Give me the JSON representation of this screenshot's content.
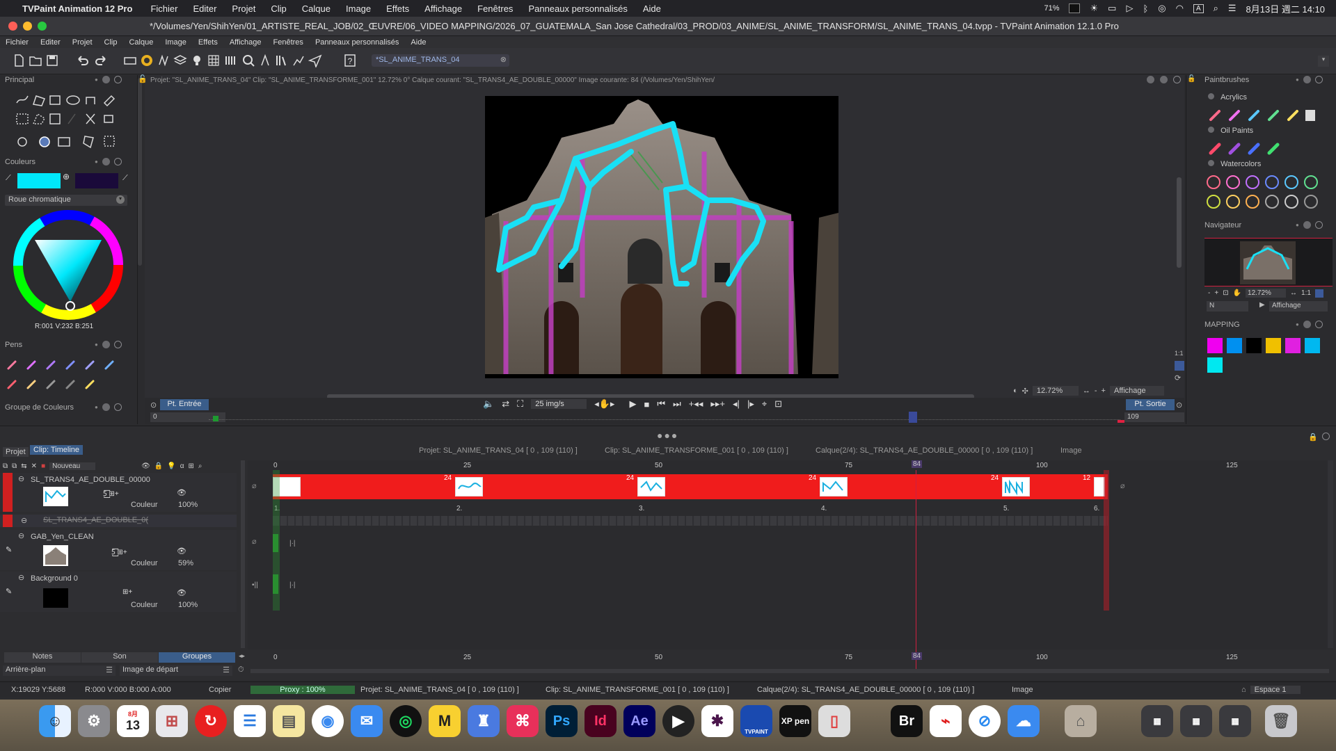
{
  "macbar": {
    "app_name": "TVPaint Animation 12 Pro",
    "menus": [
      "Fichier",
      "Editer",
      "Projet",
      "Clip",
      "Calque",
      "Image",
      "Effets",
      "Affichage",
      "Fenêtres",
      "Panneaux personnalisés",
      "Aide"
    ],
    "battery": "71%",
    "datetime": "8月13日 週二  14:10"
  },
  "titlebar": {
    "title": "*/Volumes/Yen/ShihYen/01_ARTISTE_REAL_JOB/02_ŒUVRE/06_VIDEO MAPPING/2026_07_GUATEMALA_San Jose Cathedral/03_PROD/03_ANIME/SL_ANIME_TRANSFORM/SL_ANIME_TRANS_04.tvpp - TVPaint Animation 12.1.0 Pro"
  },
  "appmenu": [
    "Fichier",
    "Editer",
    "Projet",
    "Clip",
    "Calque",
    "Image",
    "Effets",
    "Affichage",
    "Fenêtres",
    "Panneaux personnalisés",
    "Aide"
  ],
  "toolbar": {
    "tab_label": "*SL_ANIME_TRANS_04"
  },
  "infobar": {
    "text": "Projet: \"SL_ANIME_TRANS_04\"  Clip: \"SL_ANIME_TRANSFORME_001\"  12.72%  0°  Calque courant: \"SL_TRANS4_AE_DOUBLE_00000\"  Image courante: 84 (/Volumes/Yen/ShihYen/"
  },
  "left_panel": {
    "principal_title": "Principal",
    "couleurs_title": "Couleurs",
    "color_mode": "Roue chromatique",
    "rgb_readout": "R:001 V:232 B:251",
    "primary_color": "#00e8fb",
    "secondary_color": "#1a0a3a",
    "pens_title": "Pens",
    "groupe_title": "Groupe de Couleurs"
  },
  "right_panel": {
    "paintbrushes_title": "Paintbrushes",
    "acrylics": "Acrylics",
    "oil_paints": "Oil Paints",
    "watercolors": "Watercolors",
    "navigator_title": "Navigateur",
    "nav_zoom": "12.72%",
    "nav_mode": "N",
    "nav_display": "Affichage",
    "mapping_title": "MAPPING",
    "mapping_colors": [
      "#f000f0",
      "#0090f0",
      "#000000",
      "#f0c000",
      "#e020e0",
      "#00b8f0",
      "#00e8f0"
    ]
  },
  "viewer": {
    "pt_entree": "Pt. Entrée",
    "pt_sortie": "Pt. Sortie",
    "in_value": "0",
    "out_value": "109",
    "fps": "25 img/s",
    "zoom": "12.72%",
    "display": "Affichage"
  },
  "timeline": {
    "tabs": [
      "Projet",
      "Clip: Timeline"
    ],
    "nouveau": "Nouveau",
    "header_project": "Projet: SL_ANIME_TRANS_04 [ 0 , 109  (110) ]",
    "header_clip": "Clip: SL_ANIME_TRANSFORME_001 [ 0 , 109  (110) ]",
    "header_layer": "Calque(2/4): SL_TRANS4_AE_DOUBLE_00000 [ 0 , 109  (110) ]",
    "header_image": "Image",
    "ticks": [
      "0",
      "25",
      "50",
      "75",
      "84",
      "100",
      "125"
    ],
    "layers": [
      {
        "name": "SL_TRANS4_AE_DOUBLE_00000",
        "mode": "Couleur",
        "opacity": "100%"
      },
      {
        "name": "SL_TRANS4_AE_DOUBLE_0("
      },
      {
        "name": "GAB_Yen_CLEAN",
        "mode": "Couleur",
        "opacity": "59%"
      },
      {
        "name": "Background 0",
        "mode": "Couleur",
        "opacity": "100%"
      }
    ],
    "segment_labels": [
      "24",
      "24",
      "24",
      "24",
      "12"
    ],
    "segment_numbers": [
      "1.",
      "2.",
      "3.",
      "4.",
      "5.",
      "6."
    ],
    "bottom_tabs": [
      "Notes",
      "Son",
      "Groupes"
    ],
    "arriere_plan": "Arrière-plan",
    "image_depart": "Image de départ"
  },
  "statusbar": {
    "coords": "X:19029  Y:5688",
    "rgba": "R:000 V:000 B:000 A:000",
    "copier": "Copier",
    "proxy": "Proxy : 100%",
    "project": "Projet: SL_ANIME_TRANS_04 [ 0 , 109  (110) ]",
    "clip": "Clip: SL_ANIME_TRANSFORME_001 [ 0 , 109  (110) ]",
    "layer": "Calque(2/4): SL_TRANS4_AE_DOUBLE_00000 [ 0 , 109  (110) ]",
    "image": "Image",
    "espace": "Espace 1"
  },
  "dock": {
    "calendar_month": "8月",
    "calendar_day": "13"
  }
}
